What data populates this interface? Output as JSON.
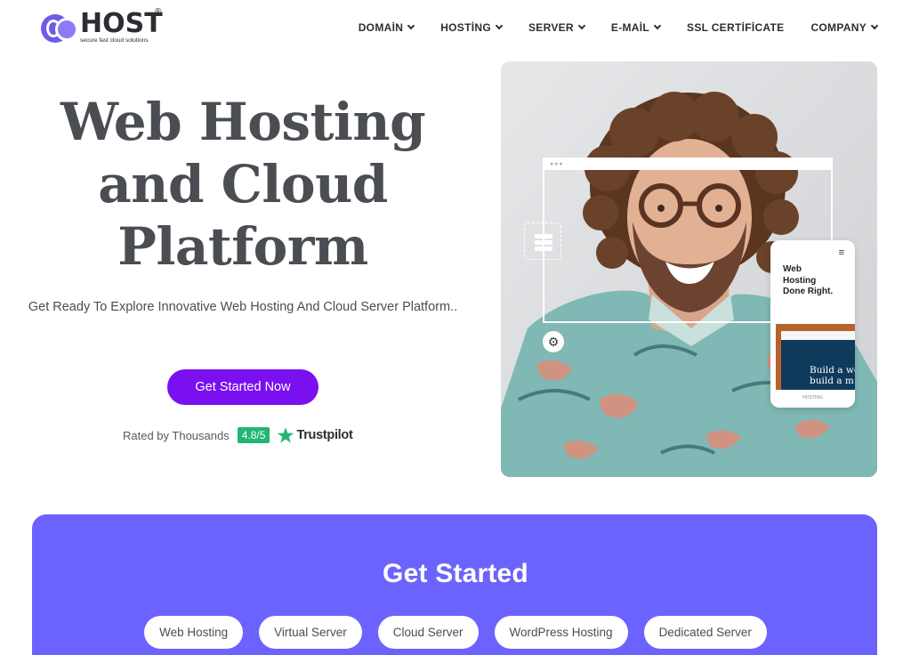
{
  "brand": {
    "name": "HOST",
    "registered": "®",
    "tagline": "secure fast cloud solutions"
  },
  "nav": {
    "items": [
      {
        "label": "DOMAİN",
        "has_dropdown": true
      },
      {
        "label": "HOSTİNG",
        "has_dropdown": true
      },
      {
        "label": "SERVER",
        "has_dropdown": true
      },
      {
        "label": "E-MAİL",
        "has_dropdown": true
      },
      {
        "label": "SSL CERTİFİCATE",
        "has_dropdown": false
      },
      {
        "label": "COMPANY",
        "has_dropdown": true
      }
    ]
  },
  "hero": {
    "title_lines": [
      "Web Hosting",
      "and Cloud",
      "Platform"
    ],
    "subtitle": "Get Ready To Explore Innovative Web Hosting And Cloud Server Platform..",
    "cta_label": "Get Started Now",
    "rating": {
      "text": "Rated by Thousands",
      "score": "4.8/5",
      "provider": "Trustpilot"
    }
  },
  "hero_image": {
    "phone_title": "Web Hosting Done Right.",
    "phone_screen_text": [
      "Build a we",
      "build a m"
    ],
    "phone_footer": "HOSTING",
    "icons": [
      "server-icon",
      "gear-icon",
      "hamburger-menu-icon"
    ]
  },
  "get_started": {
    "title": "Get Started",
    "options": [
      "Web Hosting",
      "Virtual Server",
      "Cloud Server",
      "WordPress Hosting",
      "Dedicated Server"
    ]
  },
  "colors": {
    "accent_purple": "#7a10f0",
    "band_purple": "#6c63ff",
    "logo_purple": "#6c5ce7",
    "trustpilot_green": "#22b573"
  }
}
